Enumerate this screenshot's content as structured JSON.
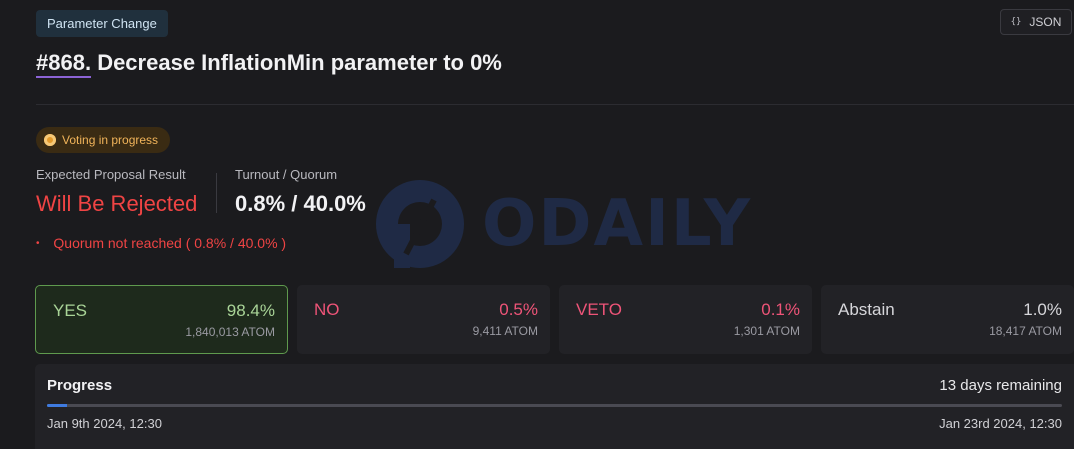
{
  "header": {
    "tag": "Parameter Change",
    "json_label": "JSON",
    "json_icon": "{}",
    "proposal_number": "#868.",
    "proposal_title": "Decrease InflationMin parameter to 0%"
  },
  "status": {
    "label": "Voting in progress",
    "color": "#f1b45a"
  },
  "result": {
    "expected_label": "Expected Proposal Result",
    "expected_value": "Will Be Rejected",
    "turnout_label": "Turnout / Quorum",
    "turnout_value": "0.8% / 40.0%",
    "quorum_bullet": "•",
    "quorum_note": "Quorum not reached ( 0.8% / 40.0% )"
  },
  "watermark": {
    "text": "ODAILY"
  },
  "votes": [
    {
      "option": "YES",
      "percent": "98.4%",
      "amount": "1,840,013 ATOM",
      "color": "#a9d497"
    },
    {
      "option": "NO",
      "percent": "0.5%",
      "amount": "9,411 ATOM",
      "color": "#ef5478"
    },
    {
      "option": "VETO",
      "percent": "0.1%",
      "amount": "1,301 ATOM",
      "color": "#ef5478"
    },
    {
      "option": "Abstain",
      "percent": "1.0%",
      "amount": "18,417 ATOM",
      "color": "#d6d6da"
    }
  ],
  "progress": {
    "title": "Progress",
    "remaining": "13 days remaining",
    "fraction": 0.02,
    "start_date": "Jan 9th 2024, 12:30",
    "end_date": "Jan 23rd 2024, 12:30"
  }
}
